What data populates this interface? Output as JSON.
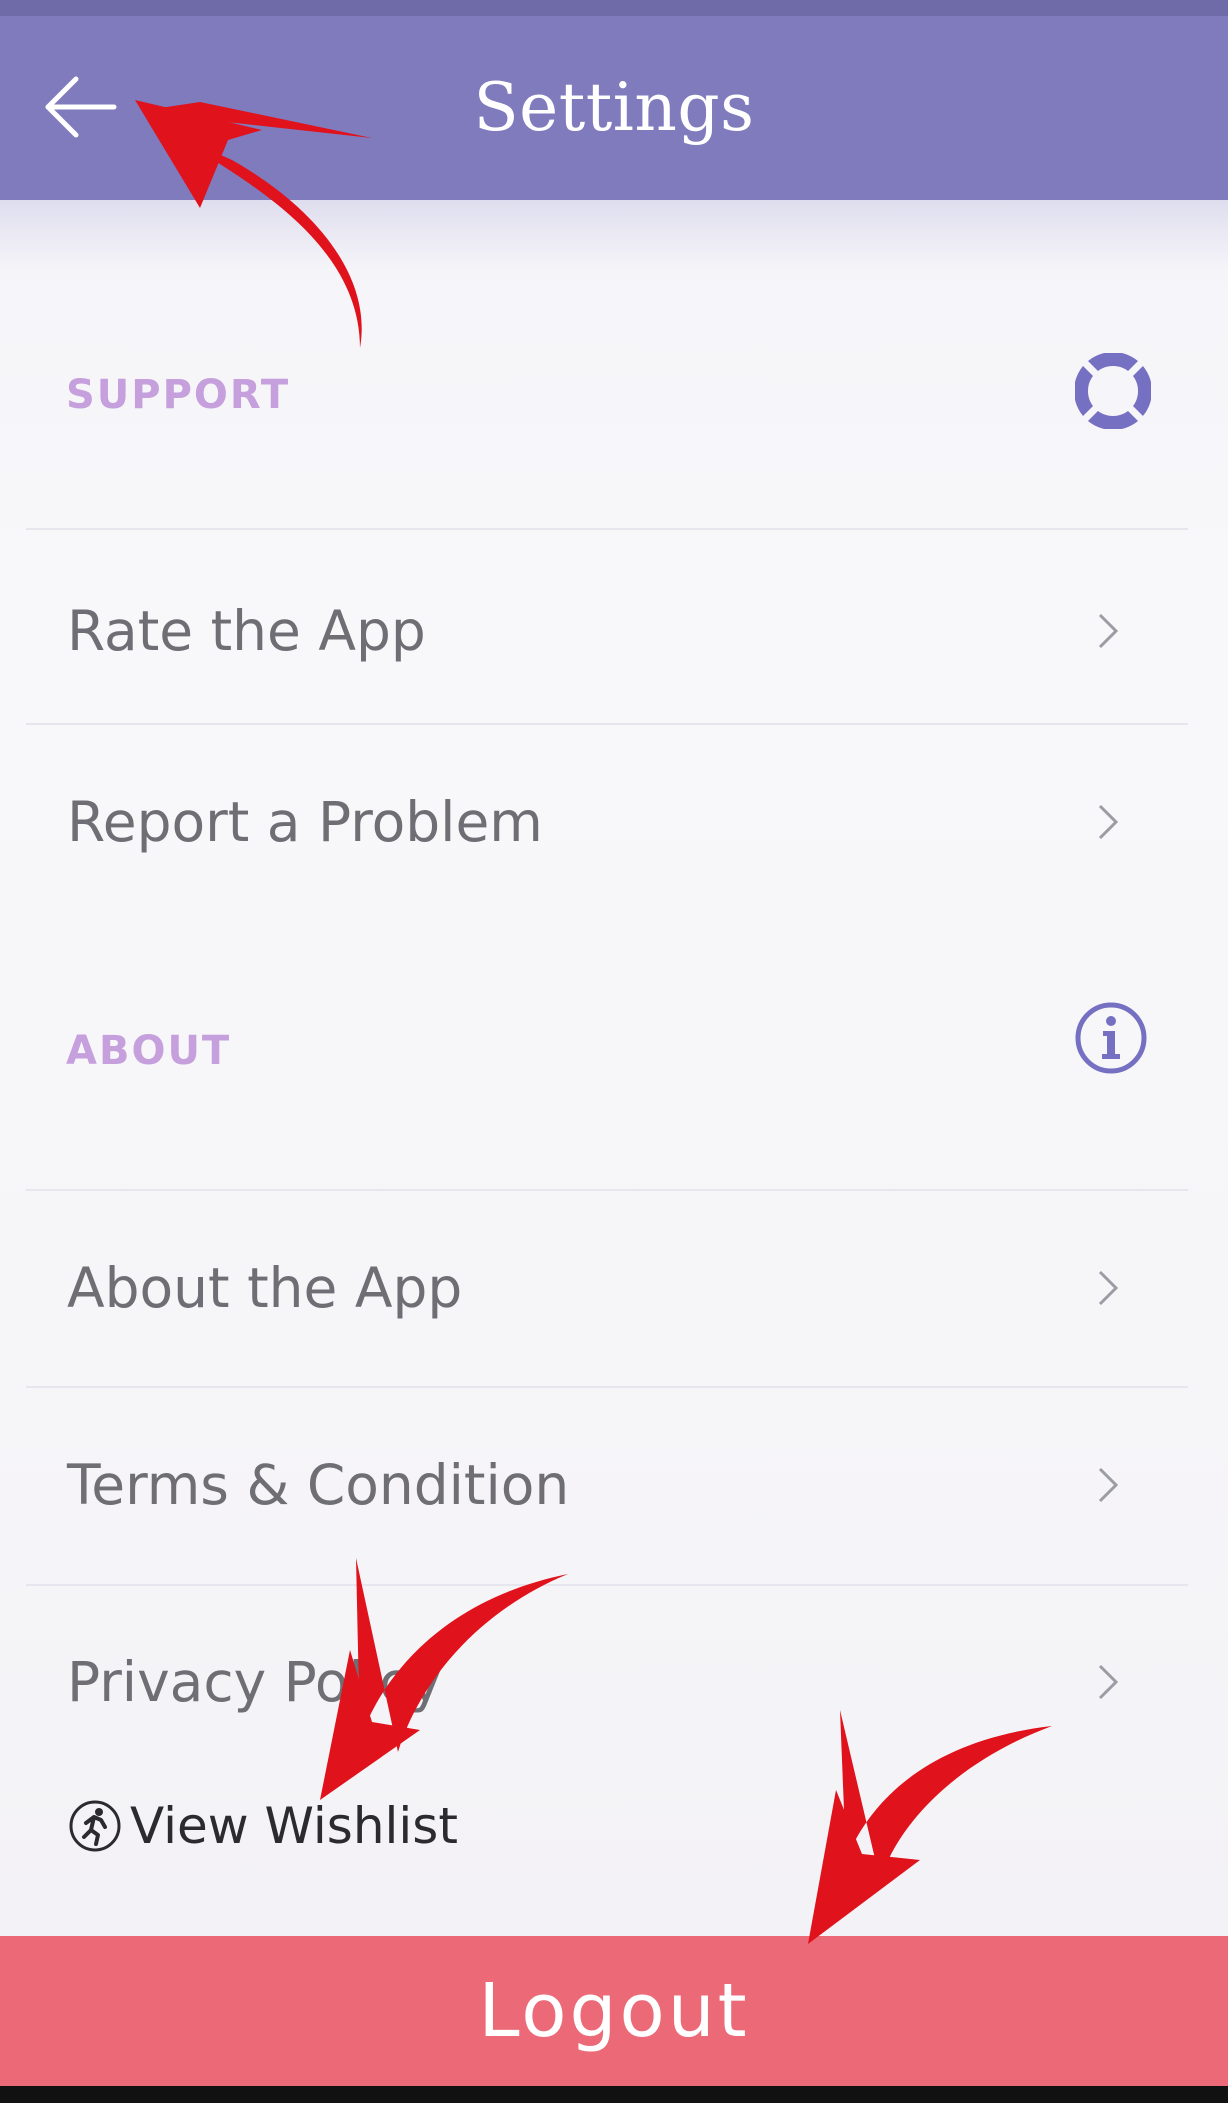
{
  "header": {
    "title": "Settings",
    "back_icon": "arrow-left-icon"
  },
  "sections": {
    "support": {
      "title": "SUPPORT",
      "icon": "lifebuoy-icon",
      "items": [
        {
          "label": "Rate the App"
        },
        {
          "label": "Report a Problem"
        }
      ]
    },
    "about": {
      "title": "ABOUT",
      "icon": "info-icon",
      "items": [
        {
          "label": "About the App"
        },
        {
          "label": "Terms & Condition"
        },
        {
          "label": "Privacy Policy"
        }
      ]
    }
  },
  "wishlist": {
    "label": "View Wishlist",
    "icon": "runner-icon"
  },
  "logout": {
    "label": "Logout"
  },
  "colors": {
    "header_bg": "#7f7bbd",
    "section_title": "#c6a0dd",
    "icon_accent": "#7670c2",
    "logout_bg": "#ec6a78",
    "annotation_arrow": "#e0121b"
  }
}
